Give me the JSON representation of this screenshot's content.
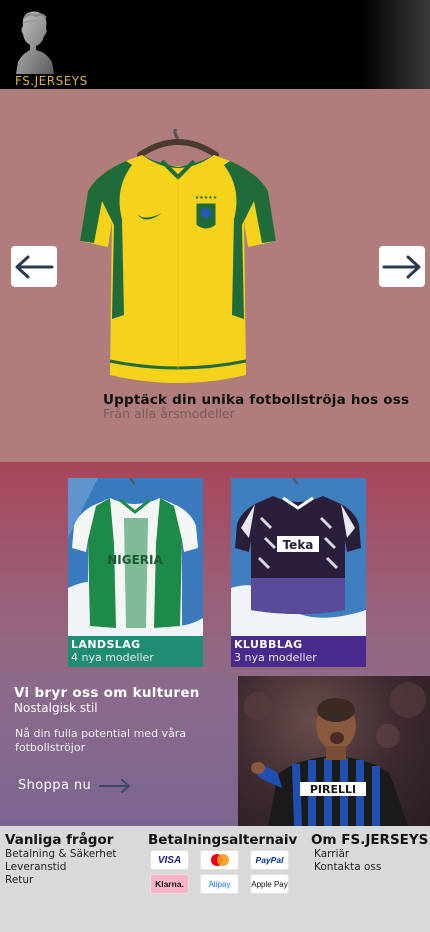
{
  "header": {
    "brand": "FS.JERSEYS",
    "brand_color": "#d8b24a",
    "logo_icon": "roman-bust-icon"
  },
  "hero": {
    "title": "Upptäck din unika fotbollströja hos oss",
    "subtitle": "Från alla årsmodeller",
    "prev_icon": "arrow-left-icon",
    "next_icon": "arrow-right-icon",
    "background": "#b07d7c"
  },
  "categories": [
    {
      "title": "LANDSLAG",
      "subtitle": "4 nya modeller",
      "jersey_text": "NIGERIA",
      "color": "#1f8d73"
    },
    {
      "title": "KLUBBLAG",
      "subtitle": "3 nya modeller",
      "jersey_text": "Teka",
      "color": "#4b2a8e"
    }
  ],
  "culture": {
    "title": "Vi bryr oss om kulturen",
    "subtitle": "Nostalgisk stil",
    "text": "Nå din fulla potential med våra fotbollströjor",
    "cta": "Shoppa nu",
    "photo_text": "PIRELLI"
  },
  "footer": {
    "faq": {
      "title": "Vanliga frågor",
      "links": [
        "Betalning & Säkerhet",
        "Leveranstid",
        "Retur"
      ]
    },
    "payment": {
      "title": "Betalningsalternaiv",
      "methods": [
        "VISA",
        "Mastercard",
        "PayPal",
        "Klarna.",
        "Alipay",
        "Apple Pay"
      ]
    },
    "about": {
      "title": "Om FS.JERSEYS",
      "links": [
        "Karriär",
        "Kontakta oss"
      ]
    }
  }
}
